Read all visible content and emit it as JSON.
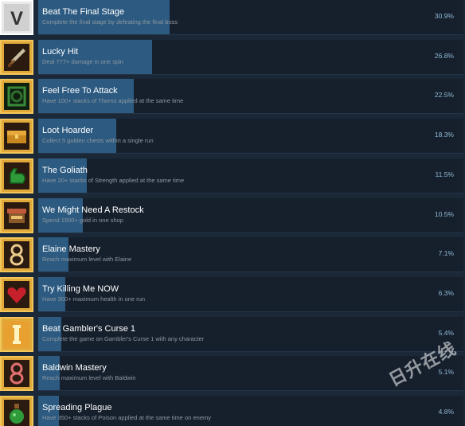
{
  "achievements": [
    {
      "title": "Beat The Final Stage",
      "desc": "Complete the final stage by defeating the final boss",
      "pct": "30.9%",
      "pct_value": 30.9,
      "icon": "roman-v-icon",
      "frame": "white"
    },
    {
      "title": "Lucky Hit",
      "desc": "Deal 777+ damage in one spin",
      "pct": "26.8%",
      "pct_value": 26.8,
      "icon": "sword-icon",
      "frame": "gold"
    },
    {
      "title": "Feel Free To Attack",
      "desc": "Have 100+ stacks of Thorns applied at the same time",
      "pct": "22.5%",
      "pct_value": 22.5,
      "icon": "thorns-icon",
      "frame": "gold"
    },
    {
      "title": "Loot Hoarder",
      "desc": "Collect 5 golden chests within a single run",
      "pct": "18.3%",
      "pct_value": 18.3,
      "icon": "treasure-chest-icon",
      "frame": "gold"
    },
    {
      "title": "The Goliath",
      "desc": "Have 20+ stacks of Strength applied at the same time",
      "pct": "11.5%",
      "pct_value": 11.5,
      "icon": "flexed-arm-icon",
      "frame": "gold"
    },
    {
      "title": "We Might Need A Restock",
      "desc": "Spend 1500+ gold in one shop",
      "pct": "10.5%",
      "pct_value": 10.5,
      "icon": "shop-stall-icon",
      "frame": "gold"
    },
    {
      "title": "Elaine Mastery",
      "desc": "Reach maximum level with Elaine",
      "pct": "7.1%",
      "pct_value": 7.1,
      "icon": "roman-eight-icon",
      "frame": "gold"
    },
    {
      "title": "Try Killing Me NOW",
      "desc": "Have 300+ maximum health in one run",
      "pct": "6.3%",
      "pct_value": 6.3,
      "icon": "heart-icon",
      "frame": "gold"
    },
    {
      "title": "Beat Gambler's Curse 1",
      "desc": "Complete the game on Gambler's Curse 1 with any character",
      "pct": "5.4%",
      "pct_value": 5.4,
      "icon": "roman-one-icon",
      "frame": "gold"
    },
    {
      "title": "Baldwin Mastery",
      "desc": "Reach maximum level with Baldwin",
      "pct": "5.1%",
      "pct_value": 5.1,
      "icon": "baldwin-icon",
      "frame": "gold"
    },
    {
      "title": "Spreading Plague",
      "desc": "Have 350+ stacks of Poison applied at the same time on enemy",
      "pct": "4.8%",
      "pct_value": 4.8,
      "icon": "poison-flask-icon",
      "frame": "gold"
    }
  ],
  "watermark": "日升在线",
  "colors": {
    "background": "#1b2838",
    "bar": "#2c5a80",
    "frame_gold": "#e0a93a",
    "pct_text": "#8fb9d4"
  }
}
